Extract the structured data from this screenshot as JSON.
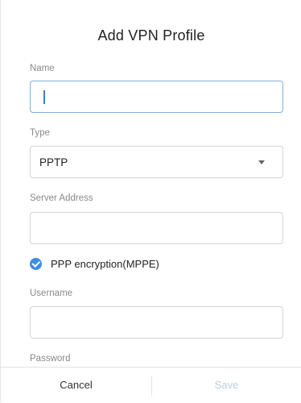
{
  "dialog": {
    "title": "Add VPN Profile"
  },
  "form": {
    "name": {
      "label": "Name",
      "value": ""
    },
    "type": {
      "label": "Type",
      "value": "PPTP"
    },
    "server_address": {
      "label": "Server Address",
      "value": ""
    },
    "ppp_encryption": {
      "label": "PPP encryption(MPPE)",
      "checked": true
    },
    "username": {
      "label": "Username",
      "value": ""
    },
    "password": {
      "label": "Password",
      "value": ""
    }
  },
  "footer": {
    "cancel_label": "Cancel",
    "save_label": "Save"
  },
  "colors": {
    "accent": "#3d8ee0",
    "focus_border": "#7fb0d8",
    "disabled_text": "#b9cde3"
  },
  "icons": {
    "checkbox": "check-circle-icon",
    "dropdown": "caret-down-icon"
  }
}
